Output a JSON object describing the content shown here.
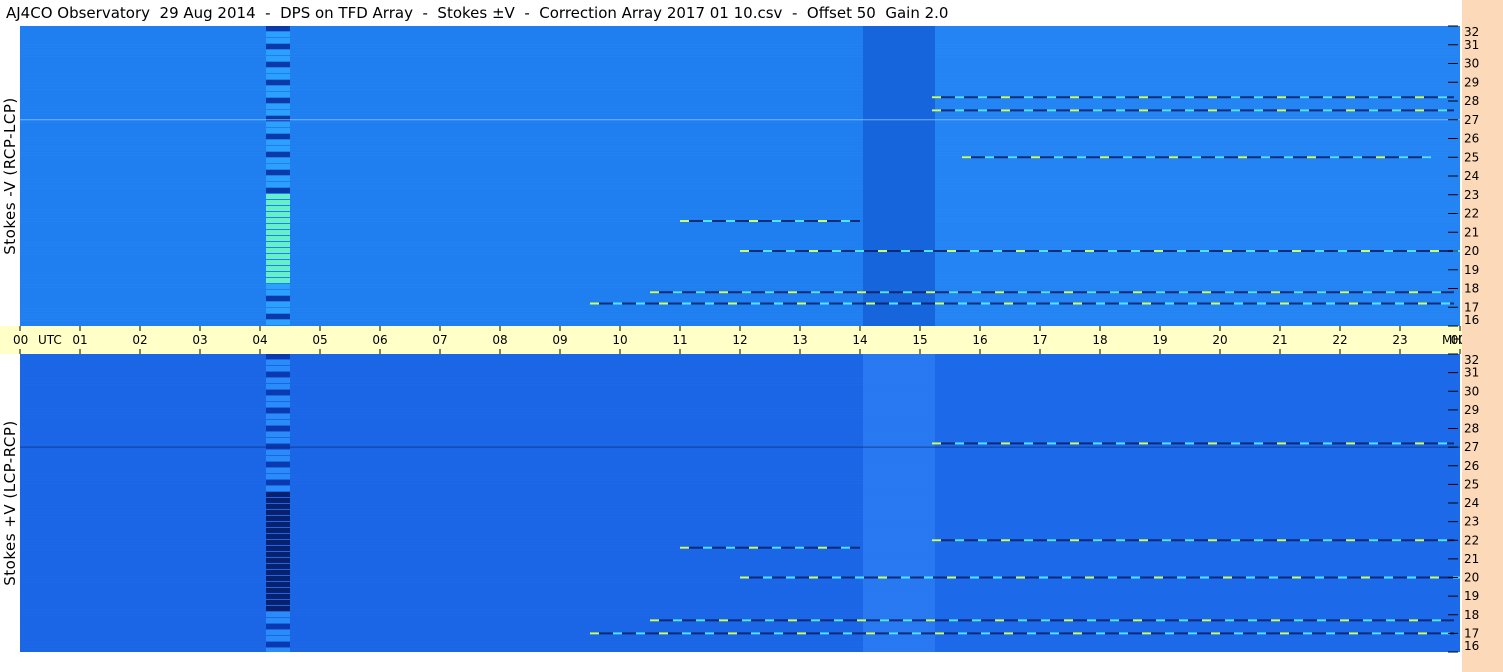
{
  "header": {
    "title": "AJ4CO Observatory  29 Aug 2014  -  DPS on TFD Array  -  Stokes ±V  -  Correction Array 2017 01 10.csv  -  Offset 50  Gain 2.0"
  },
  "colors": {
    "background_blue": "#1a73e8",
    "frame_white": "#ffffff",
    "time_axis_bg": "#ffffc8",
    "freq_strip_bg": "#fcd9b8"
  },
  "chart_data": [
    {
      "type": "heatmap",
      "panel": "top",
      "ylabel": "Stokes -V (RCP-LCP)",
      "x_axis": {
        "unit": "UTC",
        "range": [
          "00",
          "00"
        ],
        "ticks": [
          "00",
          "01",
          "02",
          "03",
          "04",
          "05",
          "06",
          "07",
          "08",
          "09",
          "10",
          "11",
          "12",
          "13",
          "14",
          "15",
          "16",
          "17",
          "18",
          "19",
          "20",
          "21",
          "22",
          "23",
          "00"
        ]
      },
      "y_axis": {
        "unit": "MHz",
        "range": [
          16,
          32
        ],
        "ticks": [
          16,
          17,
          18,
          19,
          20,
          21,
          22,
          23,
          24,
          25,
          26,
          27,
          28,
          29,
          30,
          31,
          32
        ]
      },
      "features": [
        {
          "kind": "column",
          "x_hours": [
            4.1,
            4.5
          ],
          "note_color": "strong"
        },
        {
          "kind": "band",
          "x_hours": [
            14.05,
            15.25
          ],
          "shade": "darker"
        },
        {
          "kind": "line",
          "freq_mhz": 17.2,
          "x_hours": [
            9.5,
            23.9
          ]
        },
        {
          "kind": "line",
          "freq_mhz": 17.8,
          "x_hours": [
            10.5,
            23.9
          ]
        },
        {
          "kind": "line",
          "freq_mhz": 20.0,
          "x_hours": [
            12.0,
            23.9
          ]
        },
        {
          "kind": "line",
          "freq_mhz": 21.6,
          "x_hours": [
            11.0,
            14.0
          ]
        },
        {
          "kind": "line",
          "freq_mhz": 25.0,
          "x_hours": [
            15.7,
            23.5
          ]
        },
        {
          "kind": "line",
          "freq_mhz": 27.5,
          "x_hours": [
            15.2,
            23.9
          ]
        },
        {
          "kind": "line",
          "freq_mhz": 28.2,
          "x_hours": [
            15.2,
            23.9
          ]
        }
      ]
    },
    {
      "type": "heatmap",
      "panel": "bottom",
      "ylabel": "Stokes +V (LCP-RCP)",
      "x_axis": {
        "unit": "UTC",
        "range": [
          "00",
          "00"
        ]
      },
      "y_axis": {
        "unit": "MHz",
        "range": [
          16,
          32
        ],
        "ticks": [
          16,
          17,
          18,
          19,
          20,
          21,
          22,
          23,
          24,
          25,
          26,
          27,
          28,
          29,
          30,
          31,
          32
        ]
      },
      "features": [
        {
          "kind": "column",
          "x_hours": [
            4.1,
            4.5
          ],
          "note_color": "dark"
        },
        {
          "kind": "band",
          "x_hours": [
            14.05,
            15.25
          ],
          "shade": "lighter"
        },
        {
          "kind": "line",
          "freq_mhz": 17.0,
          "x_hours": [
            9.5,
            23.9
          ]
        },
        {
          "kind": "line",
          "freq_mhz": 17.7,
          "x_hours": [
            10.5,
            23.9
          ]
        },
        {
          "kind": "line",
          "freq_mhz": 20.0,
          "x_hours": [
            12.0,
            23.9
          ]
        },
        {
          "kind": "line",
          "freq_mhz": 21.6,
          "x_hours": [
            11.0,
            14.0
          ]
        },
        {
          "kind": "line",
          "freq_mhz": 22.0,
          "x_hours": [
            15.2,
            23.9
          ]
        },
        {
          "kind": "line",
          "freq_mhz": 27.2,
          "x_hours": [
            15.2,
            23.9
          ]
        }
      ]
    }
  ],
  "axis_labels": {
    "utc": "UTC",
    "mhz": "MHz",
    "hours": [
      "00",
      "01",
      "02",
      "03",
      "04",
      "05",
      "06",
      "07",
      "08",
      "09",
      "10",
      "11",
      "12",
      "13",
      "14",
      "15",
      "16",
      "17",
      "18",
      "19",
      "20",
      "21",
      "22",
      "23",
      "00"
    ],
    "freqs": [
      "16",
      "17",
      "18",
      "19",
      "20",
      "21",
      "22",
      "23",
      "24",
      "25",
      "26",
      "27",
      "28",
      "29",
      "30",
      "31",
      "32"
    ]
  }
}
